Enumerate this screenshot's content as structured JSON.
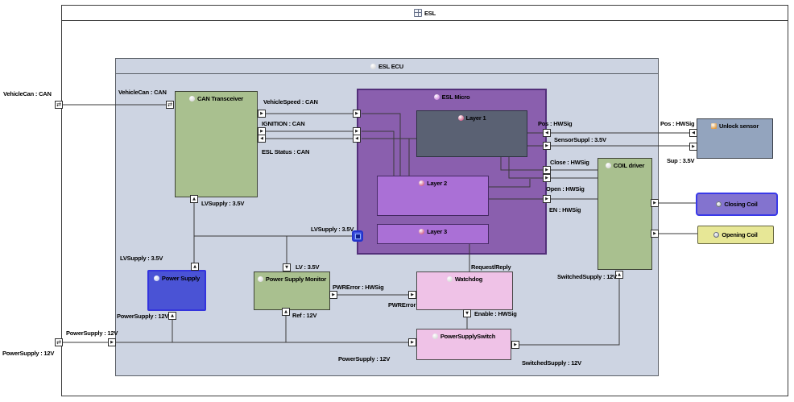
{
  "diagram": {
    "frame_title": "ESL",
    "ecu_title": "ESL ECU"
  },
  "colors": {
    "line": "#3a3a3a",
    "ecu_fill": "#cdd4e2",
    "green": "#a9c08f",
    "micro_purple": "#8a5fae",
    "layer_purple": "#aa70d6",
    "layer_slate": "#5a6173",
    "supply_blue": "#4a53d5",
    "pink": "#efc2e7",
    "sensor_steel": "#93a4be",
    "coil_purple": "#8373cf",
    "coil_yellow": "#e7e796",
    "highlight_blue": "#2233cc"
  },
  "blocks": [
    {
      "id": "esl-frame",
      "label": "ESL",
      "kind": "frame",
      "fill": "#ffffff",
      "border": "#3c3c3c",
      "bw": 1,
      "icon": "diagram-icon",
      "icon_color": "#667088"
    },
    {
      "id": "esl-ecu",
      "label": "ESL ECU",
      "kind": "container",
      "fill": "#cdd4e2",
      "border": "#5a5f66",
      "bw": 1,
      "icon": "sphere-icon",
      "icon_color": "#d9d9d9"
    },
    {
      "id": "can-transceiver",
      "label": "CAN Transceiver",
      "kind": "block",
      "fill": "#a9c08f",
      "border": "#3f4437",
      "bw": 1,
      "icon": "sphere-icon",
      "icon_color": "#d9d9d9"
    },
    {
      "id": "esl-micro",
      "label": "ESL Micro",
      "kind": "block",
      "fill": "#8a5fae",
      "border": "#53307a",
      "bw": 2,
      "icon": "sphere-icon",
      "icon_color": "#cf8adf"
    },
    {
      "id": "layer-1",
      "label": "Layer 1",
      "kind": "block",
      "fill": "#5a6173",
      "border": "#2e3340",
      "bw": 1,
      "icon": "sphere-icon",
      "icon_color": "#d0608a"
    },
    {
      "id": "layer-2",
      "label": "Layer 2",
      "kind": "block",
      "fill": "#aa70d6",
      "border": "#452a63",
      "bw": 1,
      "icon": "sphere-icon",
      "icon_color": "#d0608a"
    },
    {
      "id": "layer-3",
      "label": "Layer 3",
      "kind": "block",
      "fill": "#aa70d6",
      "border": "#452a63",
      "bw": 1,
      "icon": "sphere-icon",
      "icon_color": "#d0608a"
    },
    {
      "id": "power-supply",
      "label": "Power Supply",
      "kind": "block",
      "fill": "#4a53d5",
      "border": "#3434dd",
      "bw": 2,
      "icon": "sphere-icon",
      "icon_color": "#c8d0f0",
      "radius": 2
    },
    {
      "id": "power-supply-monitor",
      "label": "Power Supply Monitor",
      "kind": "block",
      "fill": "#a9c08f",
      "border": "#3f4437",
      "bw": 1,
      "icon": "sphere-icon",
      "icon_color": "#d9d9d9"
    },
    {
      "id": "watchdog",
      "label": "Watchdog",
      "kind": "block",
      "fill": "#efc2e7",
      "border": "#4a4a4a",
      "bw": 1,
      "icon": "sphere-icon",
      "icon_color": "#d9d9d9"
    },
    {
      "id": "power-supply-switch",
      "label": "PowerSupplySwitch",
      "kind": "block",
      "fill": "#efc2e7",
      "border": "#4a4a4a",
      "bw": 1,
      "icon": "sphere-icon",
      "icon_color": "#d9d9d9"
    },
    {
      "id": "coil-driver",
      "label": "COIL driver",
      "kind": "block",
      "fill": "#a9c08f",
      "border": "#3f4437",
      "bw": 1,
      "icon": "sphere-icon",
      "icon_color": "#d9d9d9"
    },
    {
      "id": "unlock-sensor",
      "label": "Unlock sensor",
      "kind": "block",
      "fill": "#93a4be",
      "border": "#3a3f48",
      "bw": 1,
      "icon": "sensor-icon",
      "icon_color": "#e09a40"
    },
    {
      "id": "closing-coil",
      "label": "Closing Coil",
      "kind": "vcenter",
      "fill": "#8373cf",
      "border": "#3a3ae8",
      "bw": 2,
      "icon": "coil-icon",
      "icon_color": "#b8bcc8",
      "radius": 4
    },
    {
      "id": "opening-coil",
      "label": "Opening Coil",
      "kind": "vcenter",
      "fill": "#e7e796",
      "border": "#64643e",
      "bw": 1,
      "icon": "coil-icon",
      "icon_color": "#b8bcc8",
      "radius": 2
    }
  ],
  "ports": [
    {
      "id": "frame-vehiclecan-port",
      "kind": "both"
    },
    {
      "id": "frame-powersupply-port",
      "kind": "both"
    },
    {
      "id": "ecu-powersupply-port",
      "kind": "right"
    },
    {
      "id": "ct-vehiclecan-port",
      "kind": "both"
    },
    {
      "id": "ct-vehiclespeed-port",
      "kind": "right"
    },
    {
      "id": "ct-ignition-port",
      "kind": "right"
    },
    {
      "id": "ct-eslstatus-port",
      "kind": "left"
    },
    {
      "id": "ct-lvsupply-port",
      "kind": "up"
    },
    {
      "id": "micro-vehiclespeed-port",
      "kind": "right"
    },
    {
      "id": "micro-ignition-port",
      "kind": "right"
    },
    {
      "id": "micro-eslstatus-port",
      "kind": "left"
    },
    {
      "id": "micro-lvsupply-port",
      "kind": "blue"
    },
    {
      "id": "micro-pos-port",
      "kind": "left"
    },
    {
      "id": "micro-sensorsuppl-port",
      "kind": "right"
    },
    {
      "id": "micro-close-port",
      "kind": "right"
    },
    {
      "id": "micro-open-port",
      "kind": "right"
    },
    {
      "id": "micro-en-port",
      "kind": "right"
    },
    {
      "id": "ps-lv-port",
      "kind": "up"
    },
    {
      "id": "ps-12v-port",
      "kind": "up"
    },
    {
      "id": "psm-lv-port",
      "kind": "down"
    },
    {
      "id": "psm-ref-port",
      "kind": "up"
    },
    {
      "id": "psm-pwrerror-port",
      "kind": "right"
    },
    {
      "id": "wd-pwrerror-port",
      "kind": "right"
    },
    {
      "id": "wd-enable-port",
      "kind": "down"
    },
    {
      "id": "pss-in-port",
      "kind": "right"
    },
    {
      "id": "pss-out-port",
      "kind": "right"
    },
    {
      "id": "cd-switched-port",
      "kind": "up"
    },
    {
      "id": "cd-close-port",
      "kind": "right"
    },
    {
      "id": "cd-open-port",
      "kind": "right"
    },
    {
      "id": "us-pos-port",
      "kind": "left"
    },
    {
      "id": "us-sup-port",
      "kind": "right"
    }
  ],
  "labels": [
    {
      "id": "vehiclecan-outer",
      "text": "VehicleCan : CAN"
    },
    {
      "id": "powersupply-outer",
      "text": "PowerSupply : 12V"
    },
    {
      "id": "vehiclecan-inner",
      "text": "VehicleCan : CAN"
    },
    {
      "id": "vehiclespeed",
      "text": "VehicleSpeed : CAN"
    },
    {
      "id": "ignition",
      "text": "IGNITION : CAN"
    },
    {
      "id": "eslstatus",
      "text": "ESL Status : CAN"
    },
    {
      "id": "lvsupply-ct",
      "text": "LVSupply : 3.5V"
    },
    {
      "id": "lvsupply-left",
      "text": "LVSupply : 3.5V"
    },
    {
      "id": "lvsupply-blue",
      "text": "LVSupply : 3.5V"
    },
    {
      "id": "pos-micro",
      "text": "Pos : HWSig"
    },
    {
      "id": "sensorsuppl",
      "text": "SensorSuppl : 3.5V"
    },
    {
      "id": "close",
      "text": "Close : HWSig"
    },
    {
      "id": "open",
      "text": "Open : HWSig"
    },
    {
      "id": "en",
      "text": "EN : HWSig"
    },
    {
      "id": "pos-sensor",
      "text": "Pos : HWSig"
    },
    {
      "id": "sup",
      "text": "Sup : 3.5V"
    },
    {
      "id": "lv",
      "text": "LV : 3.5V"
    },
    {
      "id": "ref",
      "text": "Ref : 12V"
    },
    {
      "id": "pwrerror-sig",
      "text": "PWRError : HWSig"
    },
    {
      "id": "pwrerror",
      "text": "PWRError"
    },
    {
      "id": "request-reply",
      "text": "Request/Reply"
    },
    {
      "id": "enable",
      "text": "Enable : HWSig"
    },
    {
      "id": "powersupply-ps",
      "text": "PowerSupply : 12V"
    },
    {
      "id": "powersupply-ecu",
      "text": "PowerSupply : 12V"
    },
    {
      "id": "powersupply-bottom",
      "text": "PowerSupply : 12V"
    },
    {
      "id": "switchedsupply-cd",
      "text": "SwitchedSupply : 12V"
    },
    {
      "id": "switchedsupply-bottom",
      "text": "SwitchedSupply : 12V"
    }
  ]
}
